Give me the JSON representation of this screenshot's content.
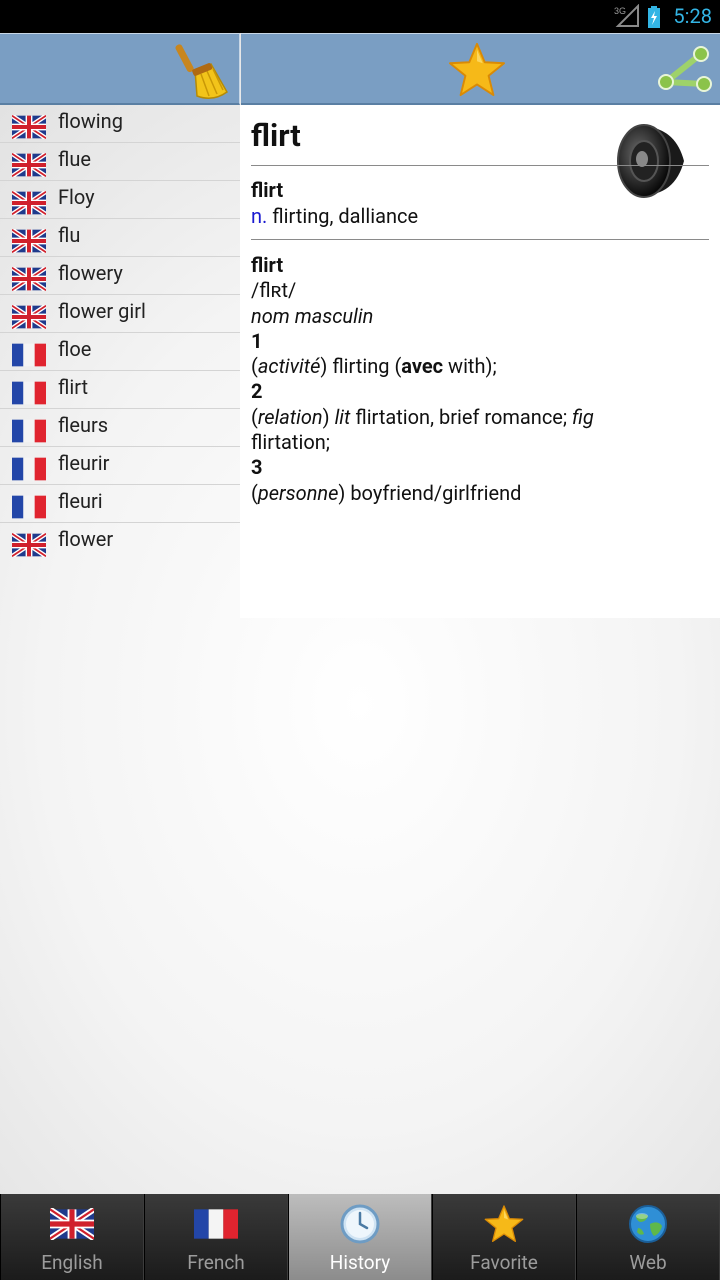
{
  "status_bar": {
    "network": "3G",
    "time": "5:28"
  },
  "header": {
    "left_icon": "broom-icon",
    "center_icon": "star-icon",
    "right_icon": "share-icon"
  },
  "history": [
    {
      "word": "flowing",
      "lang": "en"
    },
    {
      "word": "flue",
      "lang": "en"
    },
    {
      "word": "Floy",
      "lang": "en"
    },
    {
      "word": "flu",
      "lang": "en"
    },
    {
      "word": "flowery",
      "lang": "en"
    },
    {
      "word": "flower girl",
      "lang": "en"
    },
    {
      "word": "floe",
      "lang": "fr"
    },
    {
      "word": "flirt",
      "lang": "fr"
    },
    {
      "word": "fleurs",
      "lang": "fr"
    },
    {
      "word": "fleurir",
      "lang": "fr"
    },
    {
      "word": "fleuri",
      "lang": "fr"
    },
    {
      "word": "flower",
      "lang": "en"
    }
  ],
  "definition": {
    "headword": "flirt",
    "entry1": {
      "word": "flirt",
      "pos": "n.",
      "gloss": "flirting, dalliance"
    },
    "entry2": {
      "word": "flirt",
      "pronunciation": "/flʀt/",
      "gender": "nom masculin",
      "senses": [
        {
          "num": "1",
          "pre": "(",
          "context": "activité",
          "mid": ") flirting (",
          "bold": "avec",
          "post": " with);"
        },
        {
          "num": "2",
          "pre": "(",
          "context": "relation",
          "mid": ") ",
          "label1": "lit",
          "text1": " flirtation, brief romance; ",
          "label2": "fig",
          "text2": "flirtation;"
        },
        {
          "num": "3",
          "pre": "(",
          "context": "personne",
          "mid": ") boyfriend/girlfriend"
        }
      ]
    }
  },
  "tabs": [
    {
      "label": "English",
      "icon": "uk-flag-icon",
      "active": false
    },
    {
      "label": "French",
      "icon": "fr-flag-icon",
      "active": false
    },
    {
      "label": "History",
      "icon": "clock-icon",
      "active": true
    },
    {
      "label": "Favorite",
      "icon": "star-icon",
      "active": false
    },
    {
      "label": "Web",
      "icon": "globe-icon",
      "active": false
    }
  ],
  "colors": {
    "header": "#7a9ec3",
    "link_blue": "#1a1ad0",
    "status_time": "#33b5e5"
  }
}
